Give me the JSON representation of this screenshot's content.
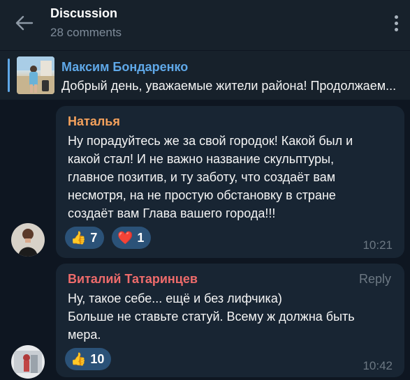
{
  "header": {
    "title": "Discussion",
    "subtitle": "28 comments"
  },
  "pinned": {
    "author": "Максим Бондаренко",
    "text": "Добрый день, уважаемые жители района! Продолжаем..."
  },
  "messages": [
    {
      "author": "Наталья",
      "author_color": "#f4a15c",
      "lines": [
        "Ну порадуйтесь же за свой городок! Какой был и",
        "какой стал! И не важно название скульптуры,",
        "главное позитив, и ту заботу, что создаёт вам",
        "несмотря, на не простую обстановку в стране",
        "создаёт вам Глава вашего города!!!"
      ],
      "reactions": [
        {
          "icon": "thumbs-up-icon",
          "count": "7"
        },
        {
          "icon": "heart-icon",
          "count": "1"
        }
      ],
      "time": "10:21"
    },
    {
      "author": "Виталий Татаринцев",
      "author_color": "#ee6b6b",
      "reply_label": "Reply",
      "lines": [
        "Ну, такое себе... ещё и без лифчика)",
        "Больше не ставьте статуй. Всему ж должна быть",
        "мера."
      ],
      "reactions": [
        {
          "icon": "thumbs-up-icon",
          "count": "10"
        }
      ],
      "time": "10:42"
    }
  ]
}
